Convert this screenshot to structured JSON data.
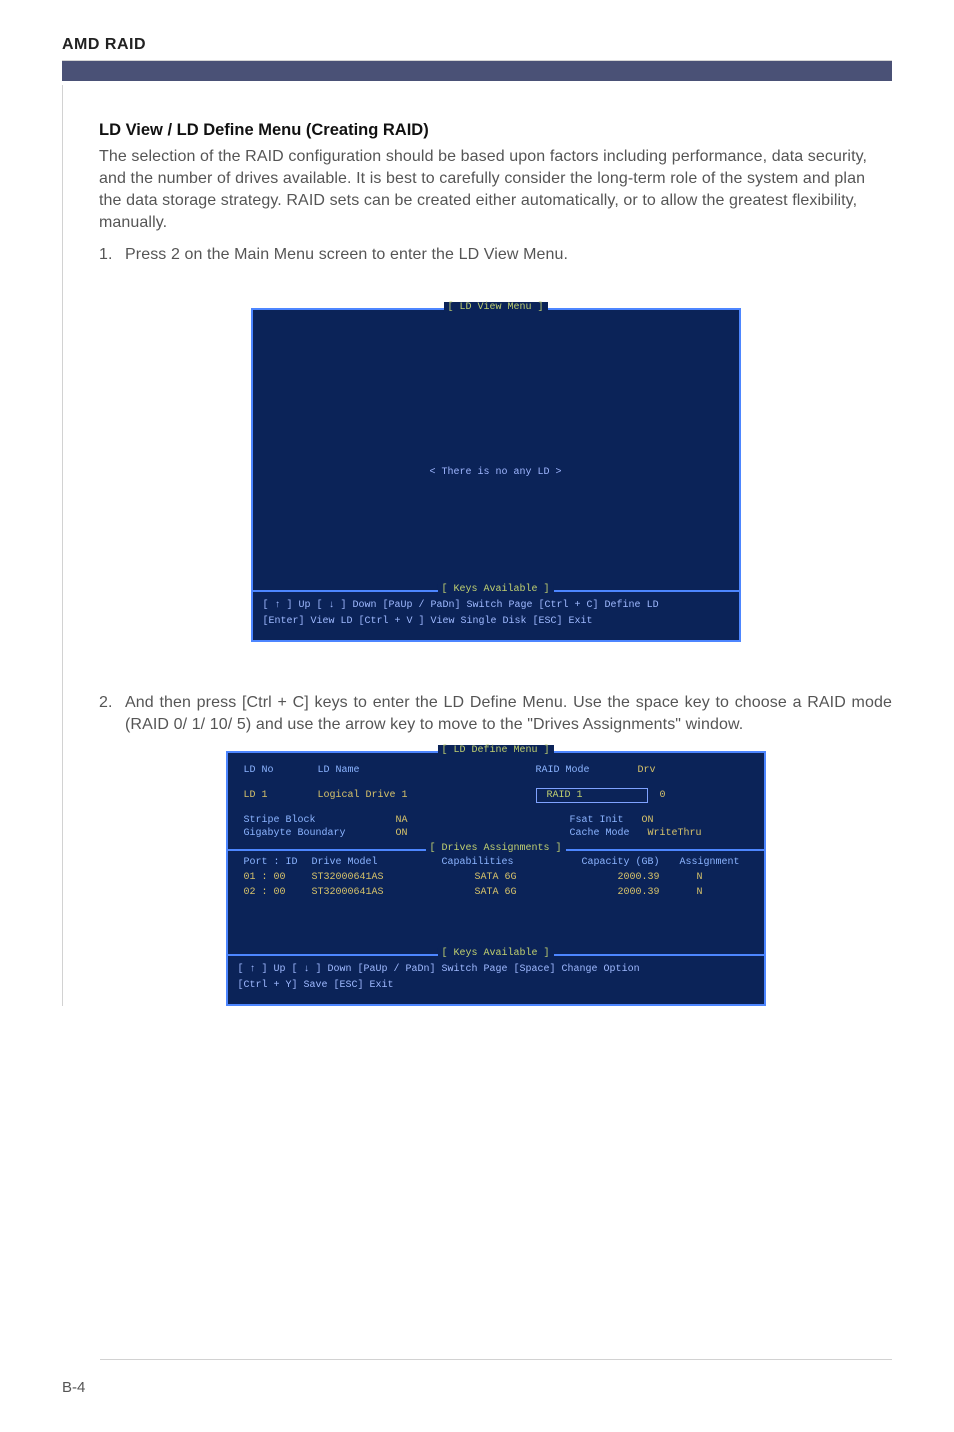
{
  "header": {
    "title": "AMD RAID"
  },
  "section": {
    "title": "LD View / LD Define Menu (Creating RAID)",
    "intro": "The selection of the RAID configuration should be based upon factors including performance, data security, and the number of drives available. It is best to carefully consider the long-term role of the system and plan the data storage strategy. RAID sets can be created either automatically, or to allow the greatest flexibility, manually.",
    "step1_num": "1.",
    "step1_text": "Press 2 on the Main Menu screen to enter the LD View Menu.",
    "step2_num": "2.",
    "step2_text": "And then press [Ctrl + C] keys to enter the LD Define Menu. Use the space key to choose a RAID mode (RAID 0/ 1/ 10/ 5) and use the arrow key to move to the \"Drives Assignments\" window."
  },
  "ldview": {
    "title": "[  LD View Menu  ]",
    "center_msg": "<  There is no any LD  >",
    "keys_title": "[ Keys Available ]",
    "keys_line1": "[ ↑ ]  Up      [ ↓ ]  Down       [PaUp / PaDn]  Switch  Page       [Ctrl + C]  Define  LD",
    "keys_line2": "[Enter]  View  LD              [Ctrl + V ]  View  Single  Disk          [ESC]  Exit"
  },
  "lddefine": {
    "title": "[  LD Define Menu  ]",
    "drives_title": "[  Drives Assignments  ]",
    "keys_title": "[ Keys Available ]",
    "hdr": {
      "ldno": "LD No",
      "ldname": "LD Name",
      "raidmode": "RAID Mode",
      "drv": "Drv"
    },
    "row": {
      "ld": "LD    1",
      "name": "Logical  Drive  1",
      "mode": "RAID  1",
      "drv": "0"
    },
    "opt": {
      "stripe_l": "Stripe Block",
      "stripe_v": "NA",
      "gb_l": "Gigabyte  Boundary",
      "gb_v": "ON",
      "fsat_l": "Fsat  Init",
      "fsat_v": "ON",
      "cache_l": "Cache  Mode",
      "cache_v": "WriteThru"
    },
    "drives_hdr": {
      "port": "Port  : ID",
      "model": "Drive  Model",
      "cap": "Capabilities",
      "capgb": "Capacity (GB)",
      "assign": "Assignment"
    },
    "drives": [
      {
        "port": "01 : 00",
        "model": "ST32000641AS",
        "cap": "SATA  6G",
        "gb": "2000.39",
        "assign": "N"
      },
      {
        "port": "02 : 00",
        "model": "ST32000641AS",
        "cap": "SATA  6G",
        "gb": "2000.39",
        "assign": "N"
      }
    ],
    "keys_line1": "[ ↑ ]  Up      [ ↓ ]  Down      [PaUp / PaDn]  Switch  Page       [Space]  Change Option",
    "keys_line2": "[Ctrl + Y]  Save           [ESC]  Exit"
  },
  "footer": {
    "pagenum": "B-4"
  }
}
